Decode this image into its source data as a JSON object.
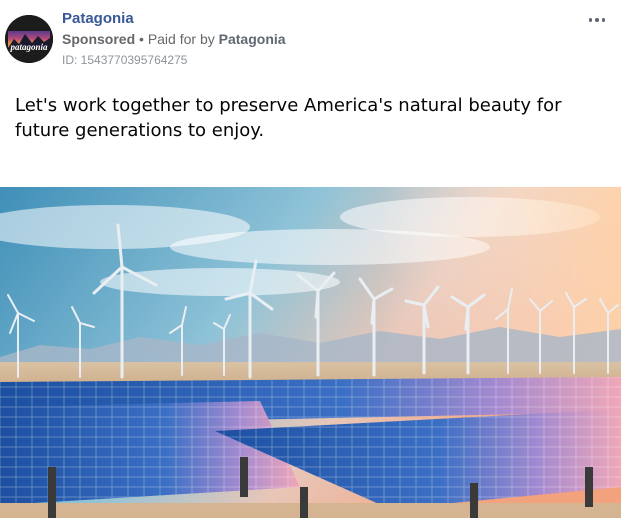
{
  "ad": {
    "page_name": "Patagonia",
    "avatar_text": "patagonia",
    "sponsored_label": "Sponsored",
    "separator": "•",
    "paid_for_by_label": "Paid for by",
    "payer_name": "Patagonia",
    "ad_id": "ID: 1543770395764275",
    "body_text": "Let's work together to preserve America's natural beauty for future generations to enjoy.",
    "icons": {
      "more": "more-options-icon"
    },
    "colors": {
      "page_name": "#385898",
      "secondary_text": "#65676b",
      "avatar_bg": "#1c1c1c"
    }
  }
}
